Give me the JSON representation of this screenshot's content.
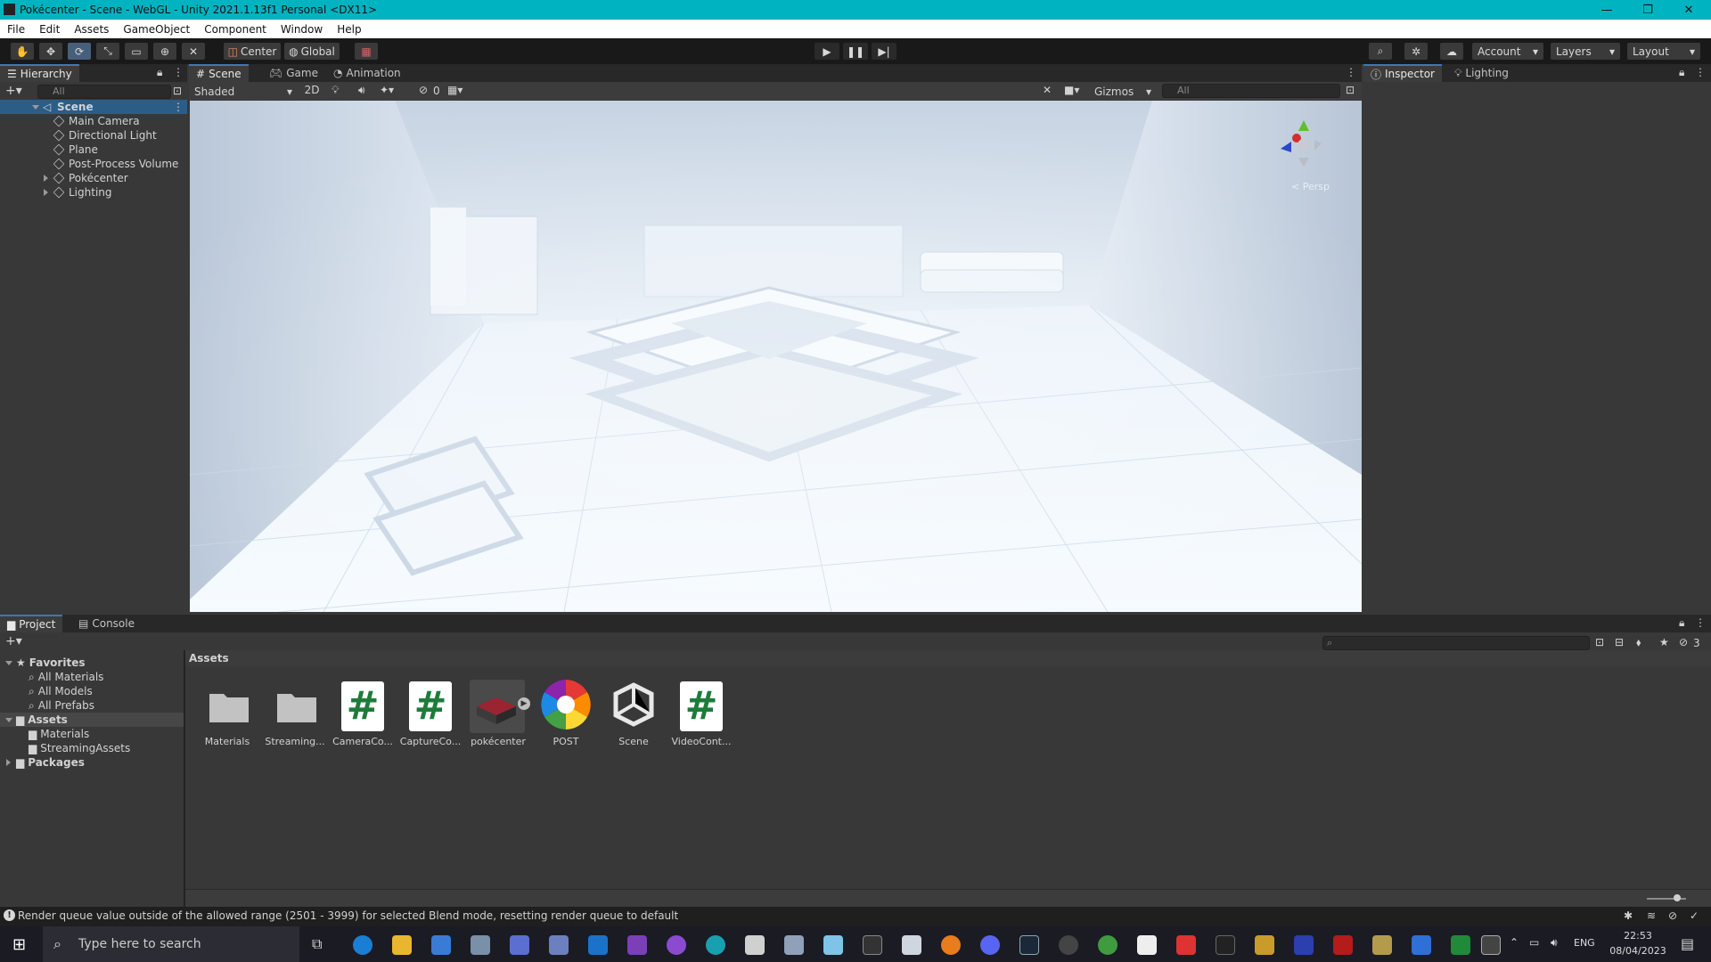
{
  "window": {
    "title": "Pokécenter - Scene - WebGL - Unity 2021.1.13f1 Personal <DX11>",
    "minimize": "—",
    "maximize": "❐",
    "close": "✕"
  },
  "menu": [
    "File",
    "Edit",
    "Assets",
    "GameObject",
    "Component",
    "Window",
    "Help"
  ],
  "toolbar": {
    "pivot_label": "Center",
    "space_label": "Global",
    "account_label": "Account",
    "layers_label": "Layers",
    "layout_label": "Layout"
  },
  "hierarchy": {
    "tab_label": "Hierarchy",
    "search_placeholder": "All",
    "scene_name": "Scene",
    "items": [
      {
        "label": "Main Camera",
        "has_children": false
      },
      {
        "label": "Directional Light",
        "has_children": false
      },
      {
        "label": "Plane",
        "has_children": false
      },
      {
        "label": "Post-Process Volume",
        "has_children": false
      },
      {
        "label": "Pokécenter",
        "has_children": true
      },
      {
        "label": "Lighting",
        "has_children": true
      }
    ]
  },
  "center_tabs": [
    "Scene",
    "Game",
    "Animation"
  ],
  "scene_toolbar": {
    "draw_mode": "Shaded",
    "mode_2d": "2D",
    "hidden_count": "0",
    "gizmos_label": "Gizmos",
    "search_placeholder": "All"
  },
  "gizmo": {
    "persp_label": "< Persp"
  },
  "inspector_tabs": [
    "Inspector",
    "Lighting"
  ],
  "bottom_tabs": [
    "Project",
    "Console"
  ],
  "project": {
    "favorites_label": "Favorites",
    "favorites": [
      "All Materials",
      "All Models",
      "All Prefabs"
    ],
    "assets_label": "Assets",
    "asset_folders": [
      "Materials",
      "StreamingAssets"
    ],
    "packages_label": "Packages",
    "breadcrumb": "Assets",
    "hidden_packages_count": "3",
    "items": [
      {
        "label": "Materials",
        "kind": "folder"
      },
      {
        "label": "Streaming...",
        "kind": "folder"
      },
      {
        "label": "CameraCo...",
        "kind": "script"
      },
      {
        "label": "CaptureCo...",
        "kind": "script"
      },
      {
        "label": "pokécenter",
        "kind": "model"
      },
      {
        "label": "POST",
        "kind": "postprocess"
      },
      {
        "label": "Scene",
        "kind": "unity-scene"
      },
      {
        "label": "VideoCont...",
        "kind": "script"
      }
    ]
  },
  "status": {
    "message": "Render queue value outside of the allowed range (2501 - 3999) for selected Blend mode, resetting render queue to default"
  },
  "taskbar": {
    "search_placeholder": "Type here to search",
    "language": "ENG",
    "time": "22:53",
    "date": "08/04/2023"
  },
  "colors": {
    "titlebar": "#00b3c0",
    "editor_bg": "#383838",
    "toolbar_bg": "#191919",
    "selected_tab_accent": "#3a79bb",
    "script_hash": "#1d7c3a"
  }
}
